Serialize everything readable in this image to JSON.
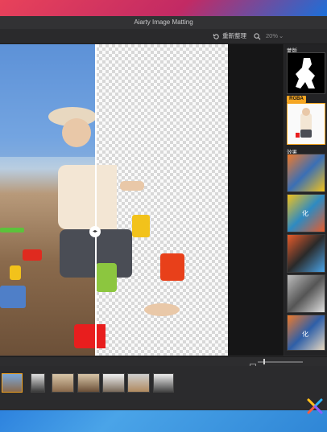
{
  "app": {
    "title": "Aiarty Image Matting"
  },
  "toolbar": {
    "reset_label": "重新整理",
    "zoom": "20%"
  },
  "sidebar": {
    "mask_label": "蒙版",
    "rgba_label": "RGBA",
    "effects_label": "效果",
    "effect_items": [
      "",
      "化",
      "",
      "",
      "",
      "化"
    ]
  },
  "bottombar": {},
  "filmstrip": {
    "count": 7
  },
  "colors": {
    "accent": "#f5a623",
    "window": "#2b2b2d"
  }
}
